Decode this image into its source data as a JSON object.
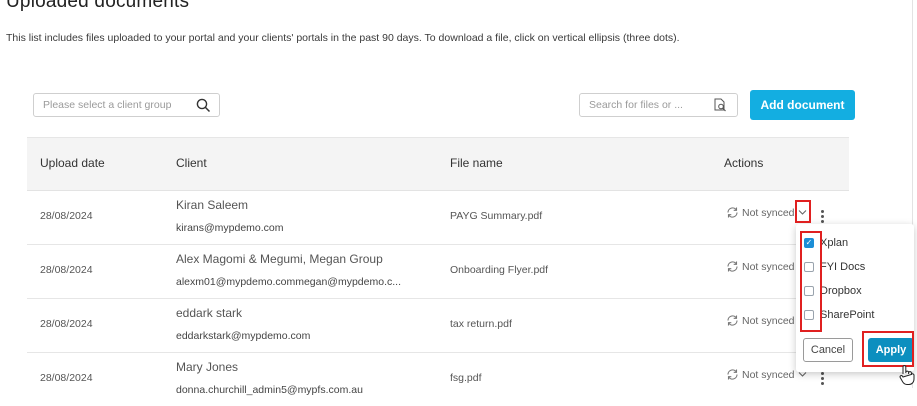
{
  "header": {
    "title": "Uploaded documents",
    "description": "This list includes files uploaded to your portal and your clients' portals in the past 90 days. To download a file, click on vertical ellipsis (three dots)."
  },
  "filters": {
    "client_placeholder": "Please select a client group",
    "file_search_placeholder": "Search for files or ...",
    "add_document_label": "Add document"
  },
  "table": {
    "columns": [
      "Upload date",
      "Client",
      "File name",
      "Actions"
    ],
    "rows": [
      {
        "date": "28/08/2024",
        "client_name": "Kiran Saleem",
        "client_email": "kirans@mypdemo.com",
        "file": "PAYG Summary.pdf",
        "status": "Not synced"
      },
      {
        "date": "28/08/2024",
        "client_name": "Alex Magomi & Megumi, Megan Group",
        "client_email": "alexm01@mypdemo.commegan@mypdemo.c...",
        "file": "Onboarding Flyer.pdf",
        "status": "Not synced"
      },
      {
        "date": "28/08/2024",
        "client_name": "eddark stark",
        "client_email": "eddarkstark@mypdemo.com",
        "file": "tax return.pdf",
        "status": "Not synced"
      },
      {
        "date": "28/08/2024",
        "client_name": "Mary Jones",
        "client_email": "donna.churchill_admin5@mypfs.com.au",
        "file": "fsg.pdf",
        "status": "Not synced"
      }
    ]
  },
  "sync_dropdown": {
    "options": [
      {
        "label": "Xplan",
        "checked": true
      },
      {
        "label": "FYI Docs",
        "checked": false
      },
      {
        "label": "Dropbox",
        "checked": false
      },
      {
        "label": "SharePoint",
        "checked": false
      }
    ],
    "cancel_label": "Cancel",
    "apply_label": "Apply",
    "checkmark": "✓"
  },
  "colors": {
    "accent": "#13aee1",
    "apply": "#0c8fbf",
    "checkbox_on": "#1c8ed6",
    "highlight": "#e02020"
  }
}
